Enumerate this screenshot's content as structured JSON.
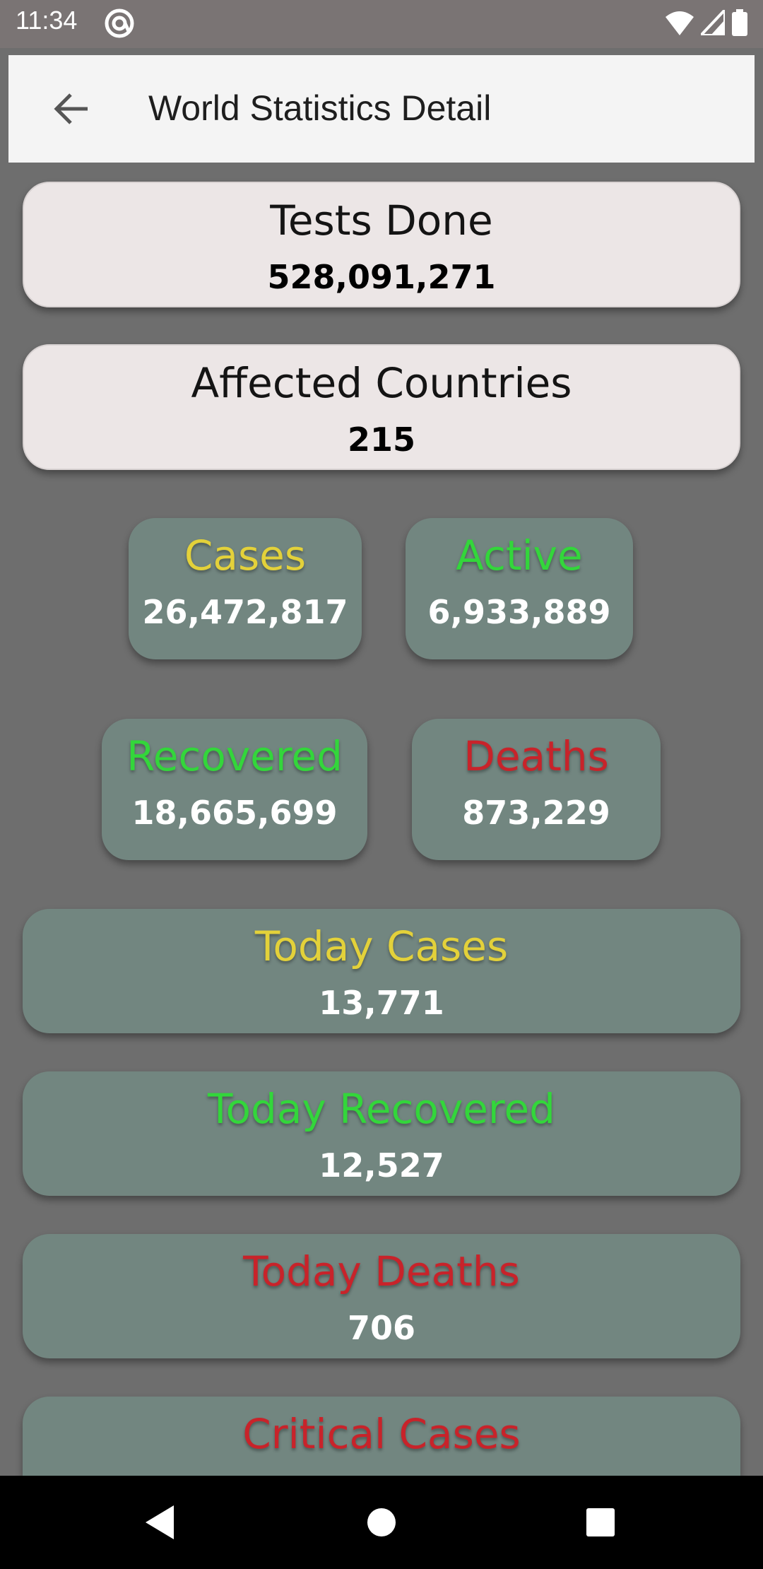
{
  "status_bar": {
    "time": "11:34"
  },
  "app_bar": {
    "title": "World Statistics Detail"
  },
  "cards": {
    "tests_done": {
      "title": "Tests Done",
      "value": "528,091,271"
    },
    "affected_countries": {
      "title": "Affected Countries",
      "value": "215"
    },
    "cases": {
      "title": "Cases",
      "value": "26,472,817",
      "color": "#e3d13a"
    },
    "active": {
      "title": "Active",
      "value": "6,933,889",
      "color": "#33d63b"
    },
    "recovered": {
      "title": "Recovered",
      "value": "18,665,699",
      "color": "#33d63b"
    },
    "deaths": {
      "title": "Deaths",
      "value": "873,229",
      "color": "#c8232a"
    },
    "today_cases": {
      "title": "Today Cases",
      "value": "13,771",
      "color": "#e3d13a"
    },
    "today_recovered": {
      "title": "Today Recovered",
      "value": "12,527",
      "color": "#33d63b"
    },
    "today_deaths": {
      "title": "Today Deaths",
      "value": "706",
      "color": "#c8232a"
    },
    "critical_cases": {
      "title": "Critical Cases",
      "color": "#c8232a"
    }
  },
  "icons": {
    "back": "arrow-back-icon",
    "wifi": "wifi-icon",
    "signal": "signal-icon",
    "battery": "battery-icon",
    "nav_back": "nav-back-icon",
    "nav_home": "nav-home-icon",
    "nav_recents": "nav-recents-icon"
  }
}
